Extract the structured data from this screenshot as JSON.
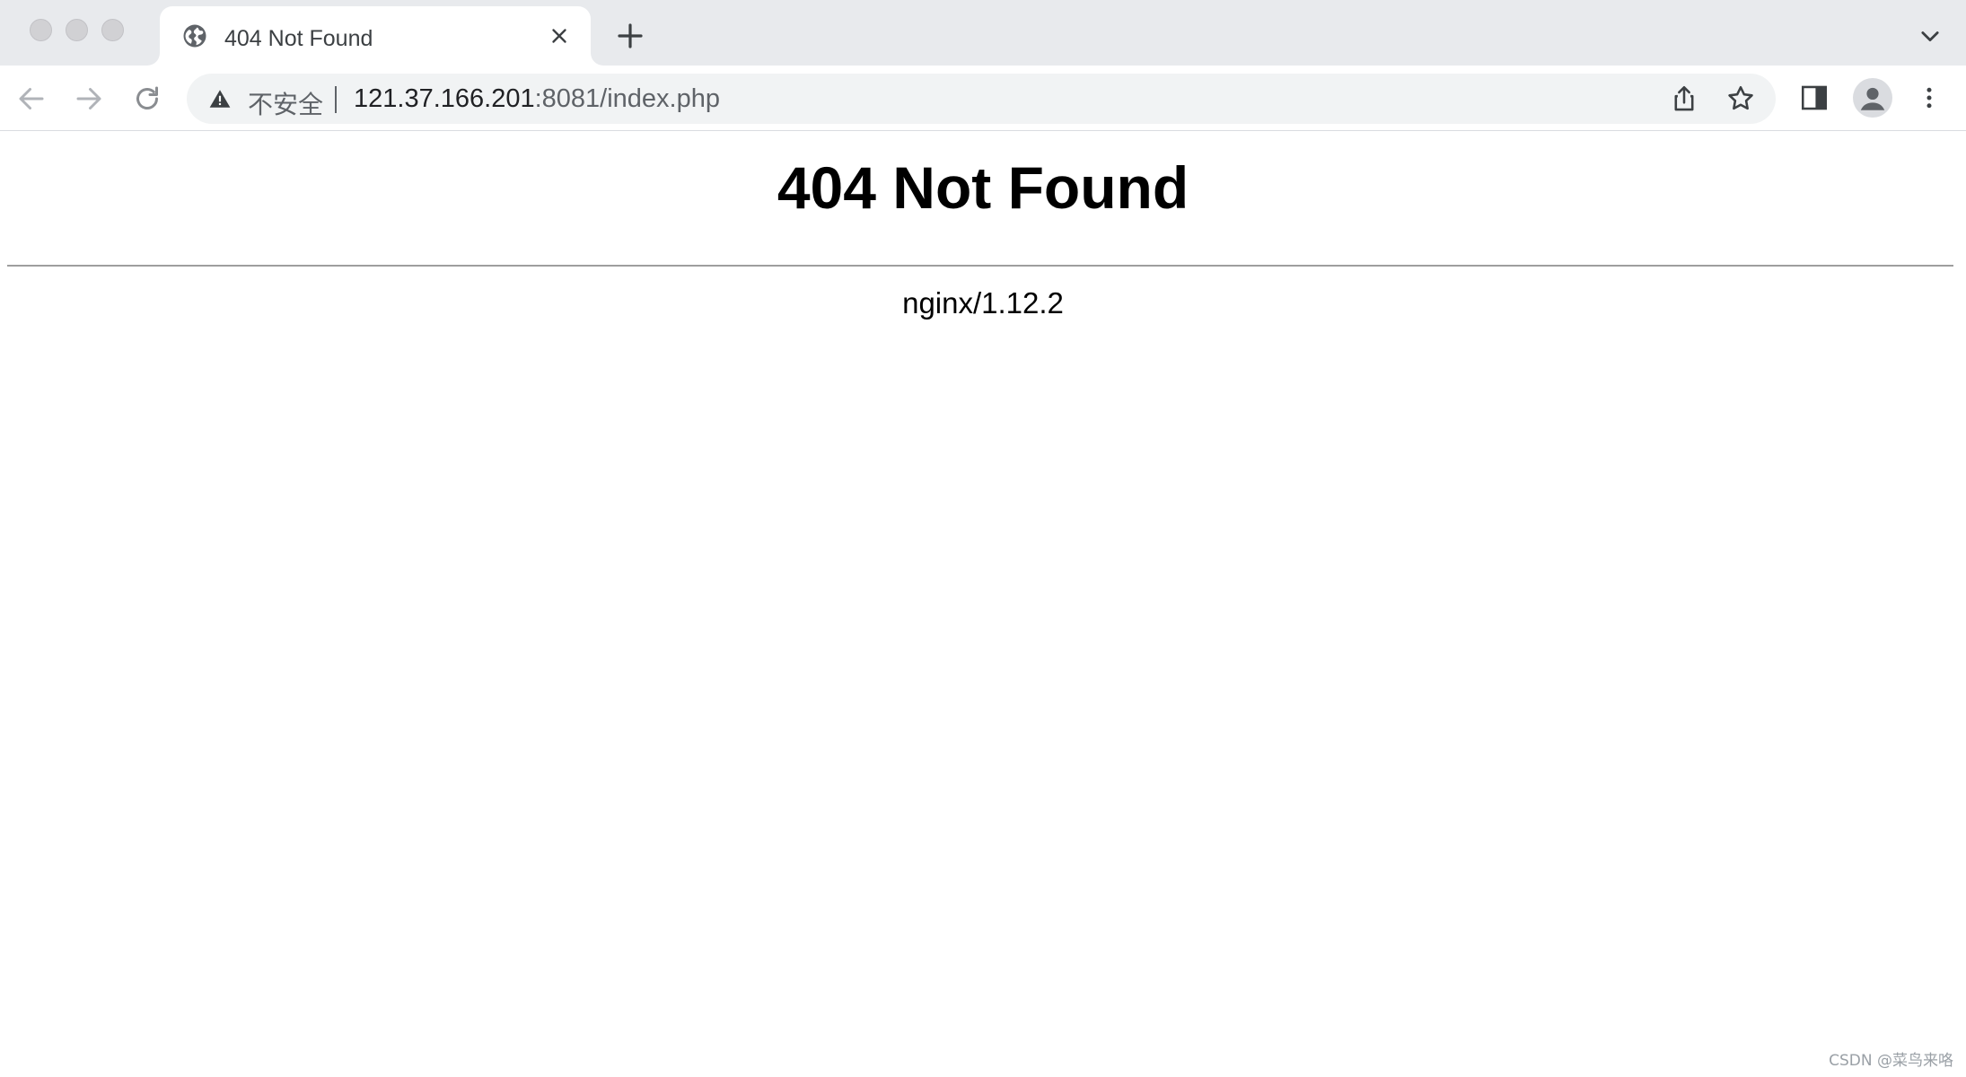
{
  "window": {
    "controls": [
      "close",
      "minimize",
      "zoom"
    ]
  },
  "tab": {
    "title": "404 Not Found",
    "favicon": "globe-icon",
    "close_icon": "close-icon"
  },
  "tabstrip": {
    "new_tab_icon": "plus-icon",
    "tab_search_icon": "chevron-down-icon"
  },
  "toolbar": {
    "back_icon": "arrow-left-icon",
    "forward_icon": "arrow-right-icon",
    "reload_icon": "reload-icon",
    "security_icon": "warning-icon",
    "security_label": "不安全",
    "url_host": "121.37.166.201",
    "url_rest": ":8081/index.php",
    "share_icon": "share-icon",
    "bookmark_icon": "star-icon",
    "side_panel_icon": "side-panel-icon",
    "profile_icon": "avatar-icon",
    "menu_icon": "more-vert-icon"
  },
  "page": {
    "heading": "404 Not Found",
    "server": "nginx/1.12.2"
  },
  "watermark": "CSDN @菜鸟来咯",
  "colors": {
    "tabstrip_bg": "#e8eaed",
    "omnibox_bg": "#f1f3f4",
    "icon_gray": "#5f6368"
  }
}
